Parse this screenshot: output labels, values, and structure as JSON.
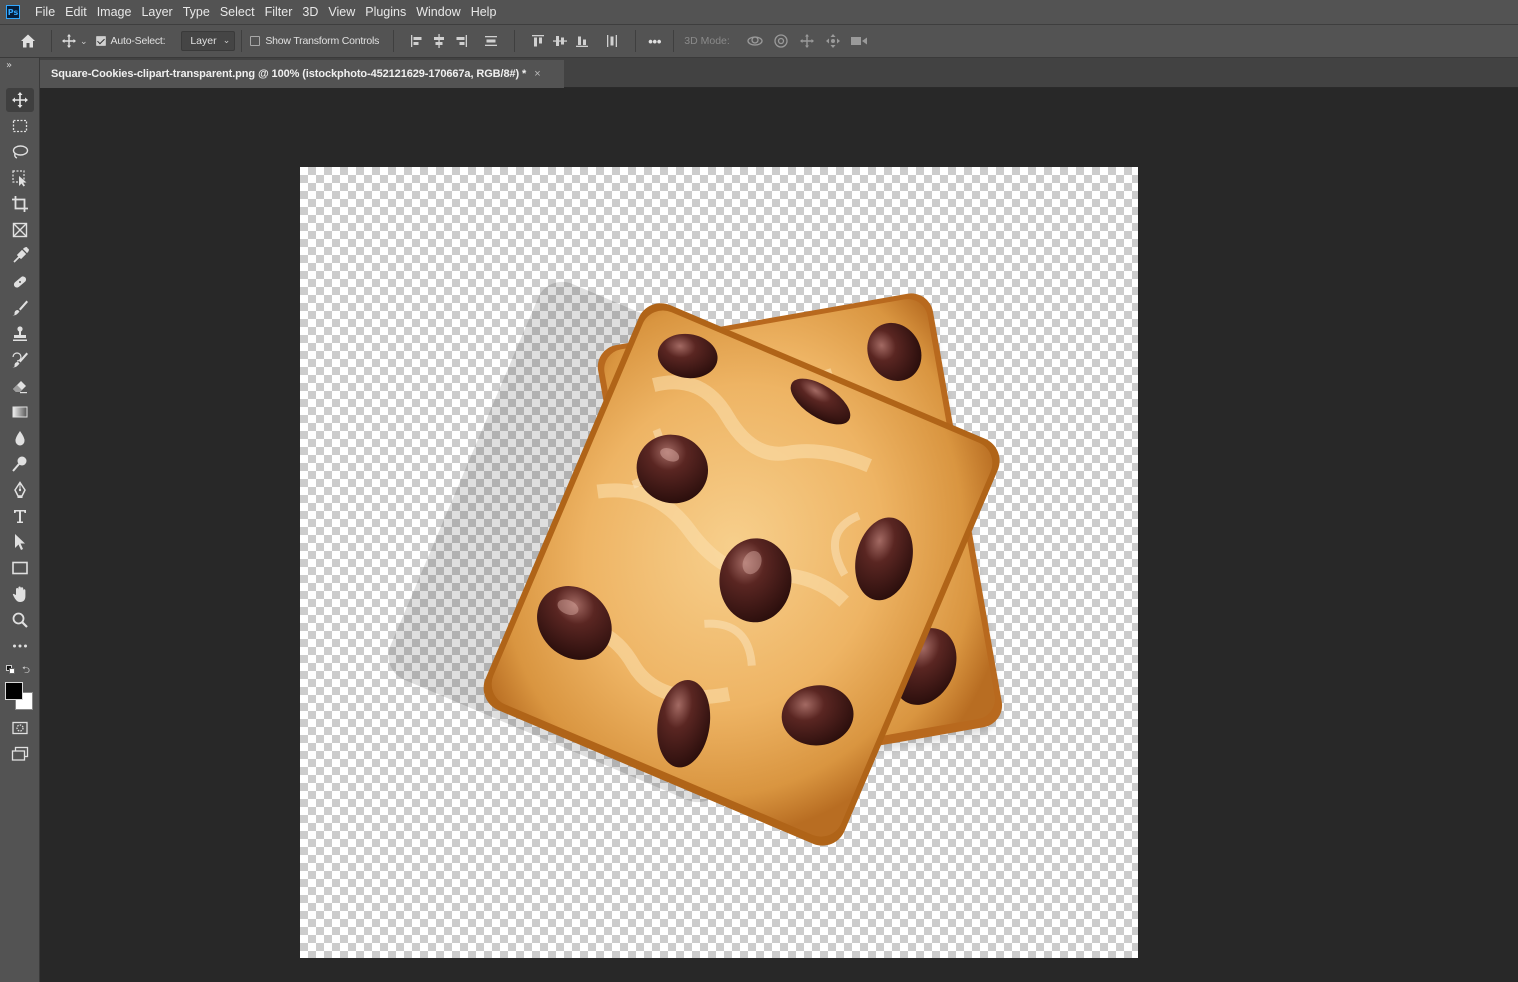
{
  "app": {
    "logo_text": "Ps"
  },
  "menu": [
    "File",
    "Edit",
    "Image",
    "Layer",
    "Type",
    "Select",
    "Filter",
    "3D",
    "View",
    "Plugins",
    "Window",
    "Help"
  ],
  "options": {
    "auto_select_label": "Auto-Select:",
    "auto_select_checked": true,
    "auto_select_target": "Layer",
    "show_transform_label": "Show Transform Controls",
    "show_transform_checked": false,
    "mode_3d_label": "3D Mode:",
    "more_label": "•••"
  },
  "document": {
    "tab_title": "Square-Cookies-clipart-transparent.png @ 100% (istockphoto-452121629-170667a, RGB/8#) *",
    "close_glyph": "×"
  },
  "toolbar": {
    "collapse_glyph": "»",
    "tools": [
      "move-tool",
      "rectangular-marquee-tool",
      "lasso-tool",
      "object-selection-tool",
      "crop-tool",
      "frame-tool",
      "eyedropper-tool",
      "spot-healing-tool",
      "brush-tool",
      "clone-stamp-tool",
      "history-brush-tool",
      "eraser-tool",
      "gradient-tool",
      "blur-tool",
      "dodge-tool",
      "pen-tool",
      "type-tool",
      "path-selection-tool",
      "rectangle-tool",
      "hand-tool",
      "zoom-tool",
      "edit-toolbar"
    ],
    "foreground_color": "#000000",
    "background_color": "#ffffff"
  },
  "colors": {
    "cookie_light": "#f4c27a",
    "cookie_dark": "#c47a2c",
    "chip": "#4a1f1c",
    "accent": "#31a8ff"
  }
}
